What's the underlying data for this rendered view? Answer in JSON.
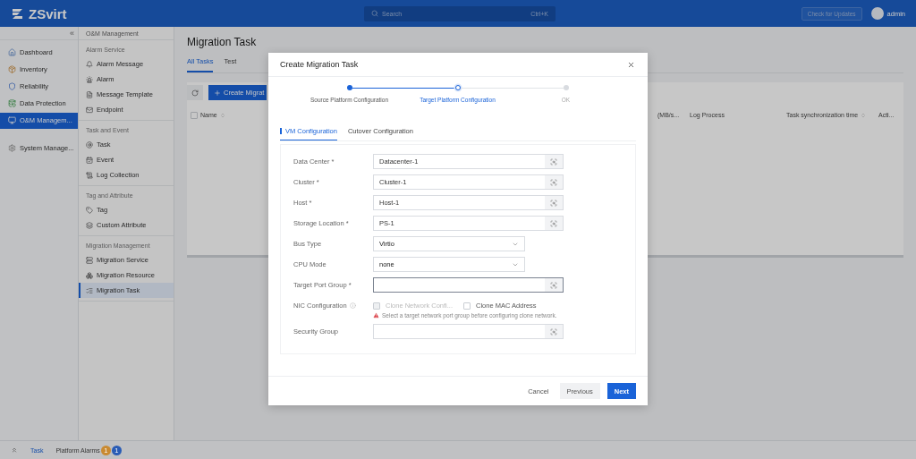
{
  "topbar": {
    "logo": "ZSvirt",
    "search": {
      "placeholder": "Search",
      "shortcut": "Ctrl+K"
    },
    "update_button": "Check for Updates",
    "user": "admin"
  },
  "nav": {
    "collapse": "«",
    "items": [
      {
        "label": "Dashboard",
        "selected": false
      },
      {
        "label": "Inventory",
        "selected": false
      },
      {
        "label": "Reliability",
        "selected": false
      },
      {
        "label": "Data Protection",
        "selected": false
      },
      {
        "label": "O&M Managem...",
        "selected": true
      },
      {
        "label": "System Manage...",
        "selected": false
      }
    ]
  },
  "subnav": {
    "title": "O&M Management",
    "groups": [
      {
        "title": "Alarm Service",
        "items": [
          {
            "label": "Alarm Message",
            "selected": false
          },
          {
            "label": "Alarm",
            "selected": false
          },
          {
            "label": "Message Template",
            "selected": false
          },
          {
            "label": "Endpoint",
            "selected": false
          }
        ]
      },
      {
        "title": "Task and Event",
        "items": [
          {
            "label": "Task",
            "selected": false
          },
          {
            "label": "Event",
            "selected": false
          },
          {
            "label": "Log Collection",
            "selected": false
          }
        ]
      },
      {
        "title": "Tag and Attribute",
        "items": [
          {
            "label": "Tag",
            "selected": false
          },
          {
            "label": "Custom Attribute",
            "selected": false
          }
        ]
      },
      {
        "title": "Migration Management",
        "items": [
          {
            "label": "Migration Service",
            "selected": false
          },
          {
            "label": "Migration Resource",
            "selected": false
          },
          {
            "label": "Migration Task",
            "selected": true
          }
        ]
      }
    ]
  },
  "page": {
    "title": "Migration Task",
    "tabs": [
      {
        "label": "All Tasks",
        "selected": true
      },
      {
        "label": "Test",
        "selected": false
      }
    ],
    "create_button": "Create Migrat",
    "table": {
      "select_all_checked": false,
      "columns": [
        "Name",
        "(MB/s...",
        "Log Process",
        "Task synchronization time",
        "Acti..."
      ]
    }
  },
  "dialog": {
    "title": "Create Migration Task",
    "steps": [
      {
        "label": "Source Platform Configuration",
        "completed": true,
        "selected": false
      },
      {
        "label": "Target Platform Configuration",
        "completed": false,
        "selected": true
      },
      {
        "label": "OK",
        "completed": false,
        "selected": false
      }
    ],
    "tabs": [
      {
        "label": "VM Configuration",
        "selected": true
      },
      {
        "label": "Cutover Configuration",
        "selected": false
      }
    ],
    "fields": [
      {
        "kind": "picker",
        "label": "Data Center *",
        "value": "Datacenter-1",
        "focused": false
      },
      {
        "kind": "picker",
        "label": "Cluster *",
        "value": "Cluster-1",
        "focused": false
      },
      {
        "kind": "picker",
        "label": "Host *",
        "value": "Host-1",
        "focused": false
      },
      {
        "kind": "picker",
        "label": "Storage Location *",
        "value": "PS-1",
        "focused": false
      },
      {
        "kind": "select",
        "label": "Bus Type",
        "value": "Virtio"
      },
      {
        "kind": "select",
        "label": "CPU Mode",
        "value": "none"
      },
      {
        "kind": "picker",
        "label": "Target Port Group *",
        "focused": true
      },
      {
        "kind": "checks",
        "label": "NIC Configuration",
        "options": [
          {
            "label": "Clone Network Confi...",
            "checked": false,
            "disabled": true
          },
          {
            "label": "Clone MAC Address",
            "checked": false,
            "disabled": false
          }
        ],
        "warning": "Select a target network port group before configuring clone network."
      },
      {
        "kind": "picker",
        "label": "Security Group",
        "focused": false
      }
    ],
    "buttons": [
      {
        "label": "Cancel",
        "kind": "text"
      },
      {
        "label": "Previous",
        "kind": "secondary"
      },
      {
        "label": "Next",
        "kind": "primary"
      }
    ]
  },
  "bottom_bar": {
    "task": "Task",
    "alarms": "Platform Alarms",
    "badges": [
      {
        "count": "1",
        "color": "#c98a32"
      },
      {
        "count": "1",
        "color": "#2a5cb5"
      }
    ]
  }
}
